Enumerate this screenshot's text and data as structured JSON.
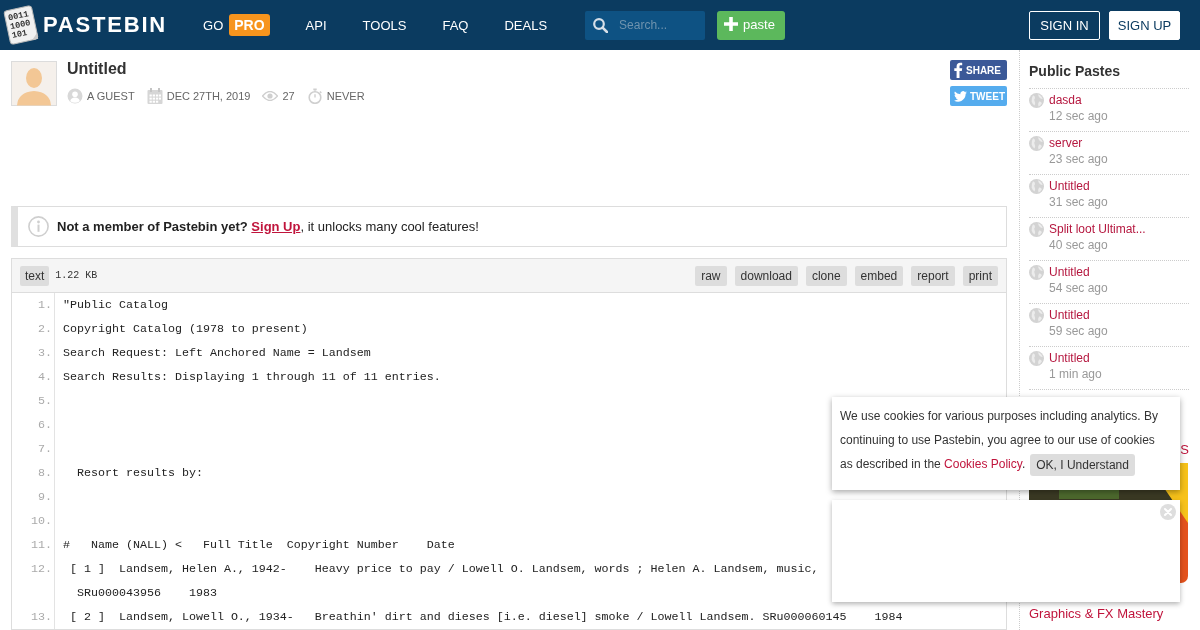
{
  "header": {
    "logo": {
      "digits": [
        "0011",
        "1000",
        "101"
      ],
      "name": "PASTEBIN"
    },
    "nav": [
      {
        "label": "GO",
        "badge": "PRO"
      },
      {
        "label": "API"
      },
      {
        "label": "TOOLS"
      },
      {
        "label": "FAQ"
      },
      {
        "label": "DEALS"
      }
    ],
    "search": {
      "placeholder": "Search..."
    },
    "new_paste_button": "paste",
    "auth_buttons": [
      {
        "label": "SIGN IN",
        "kind": "outline"
      },
      {
        "label": "SIGN UP",
        "kind": "solid"
      }
    ]
  },
  "paste": {
    "title": "Untitled",
    "meta": [
      {
        "kind": "user",
        "text": "A GUEST"
      },
      {
        "kind": "date",
        "text": "DEC 27TH, 2019"
      },
      {
        "kind": "views",
        "text": "27"
      },
      {
        "kind": "expiry",
        "text": "NEVER"
      }
    ],
    "share_buttons": [
      {
        "kind": "facebook",
        "label": "SHARE"
      },
      {
        "kind": "twitter",
        "label": "TWEET"
      }
    ]
  },
  "notice": {
    "lead": "Not a member of Pastebin yet?",
    "link": "Sign Up",
    "rest": ", it unlocks many cool features!"
  },
  "code_box": {
    "format": "text",
    "size": "1.22 KB",
    "actions": [
      "raw",
      "download",
      "clone",
      "embed",
      "report",
      "print"
    ],
    "lines": [
      {
        "number": "1.",
        "text": "\"Public Catalog"
      },
      {
        "number": "2.",
        "text": "Copyright Catalog (1978 to present)"
      },
      {
        "number": "3.",
        "text": "Search Request: Left Anchored Name = Landsem"
      },
      {
        "number": "4.",
        "text": "Search Results: Displaying 1 through 11 of 11 entries."
      },
      {
        "number": "5."
      },
      {
        "number": "6."
      },
      {
        "number": "7."
      },
      {
        "number": "8.",
        "text": "  Resort results by:"
      },
      {
        "number": "9."
      },
      {
        "number": "10."
      },
      {
        "number": "11.",
        "text": "#   Name (NALL) <   Full Title  Copyright Number    Date"
      },
      {
        "number": "12.",
        "text": " [ 1 ]  Landsem, Helen A., 1942-    Heavy price to pay / Lowell O. Landsem, words ; Helen A. Landsem, music,",
        "continuation": "  SRu000043956    1983"
      },
      {
        "number": "13.",
        "text": " [ 2 ]  Landsem, Lowell O., 1934-   Breathin' dirt and dieses [i.e. diesel] smoke / Lowell Landsem. SRu000060145    1984"
      }
    ]
  },
  "sidebar": {
    "title": "Public Pastes",
    "pastes": [
      {
        "title": "dasda",
        "age": "12 sec ago"
      },
      {
        "title": "server",
        "age": "23 sec ago"
      },
      {
        "title": "Untitled",
        "age": "31 sec ago"
      },
      {
        "title": "Split loot Ultimat...",
        "age": "40 sec ago"
      },
      {
        "title": "Untitled",
        "age": "54 sec ago"
      },
      {
        "title": "Untitled",
        "age": "59 sec ago"
      },
      {
        "title": "Untitled",
        "age": "1 min ago"
      }
    ],
    "ad": {
      "heading": "S",
      "link": "Graphics & FX Mastery"
    }
  },
  "cookie_notice": {
    "text": "We use cookies for various purposes including analytics. By continuing to use Pastebin, you agree to our use of cookies as described in the ",
    "link": "Cookies Policy",
    "after": ".",
    "button": "OK, I Understand"
  },
  "ad_overlay": {
    "closable": true
  }
}
